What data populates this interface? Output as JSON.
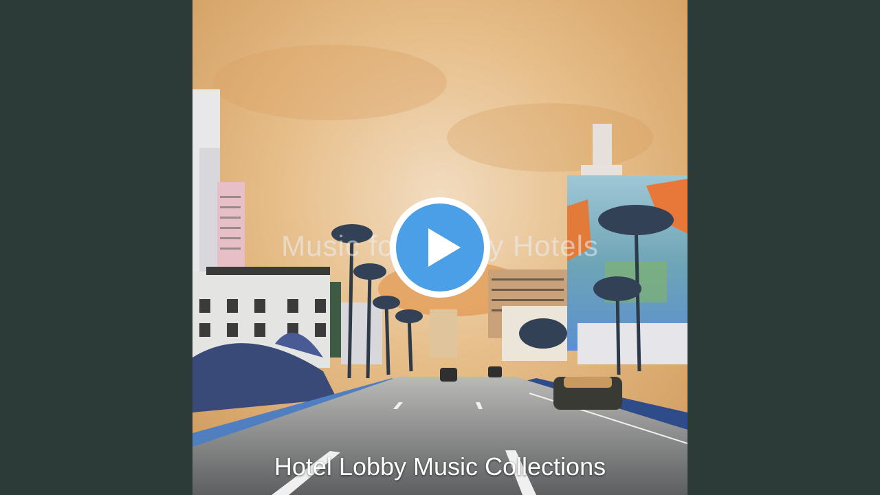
{
  "video": {
    "overlay_title": "Music for Luxury Hotels",
    "caption": "Hotel Lobby Music Collections"
  },
  "play_button": {
    "icon": "play-icon",
    "color": "#4a9fe6"
  },
  "colors": {
    "background": "#2c3b37",
    "sky": "#e0b27a"
  }
}
